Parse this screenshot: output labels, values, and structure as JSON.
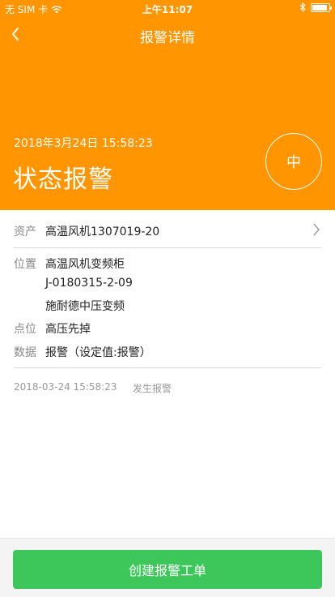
{
  "status_bar": {
    "carrier": "无 SIM 卡",
    "time": "上午11:07",
    "battery_level": 0.9,
    "icons": [
      "wifi-icon",
      "bluetooth-icon",
      "battery-icon"
    ]
  },
  "nav": {
    "title": "报警详情",
    "back_icon": "chevron-left-icon"
  },
  "alarm": {
    "time": "2018年3月24日  15:58:23",
    "title": "状态报警",
    "level": "中"
  },
  "detail": {
    "asset": {
      "label": "资产",
      "value": "高温风机1307019-20"
    },
    "location": {
      "label": "位置",
      "lines": [
        "高温风机变频柜",
        "J-0180315-2-09",
        "施耐德中压变频"
      ]
    },
    "point": {
      "label": "点位",
      "value": "高压先掉"
    },
    "data": {
      "label": "数据",
      "value": "报警（设定值:报警）"
    }
  },
  "log": {
    "time": "2018-03-24  15:58:23",
    "event": "发生报警"
  },
  "footer": {
    "create_label": "创建报警工单"
  },
  "colors": {
    "header": "#FF9500",
    "primary_button": "#3DC659"
  }
}
